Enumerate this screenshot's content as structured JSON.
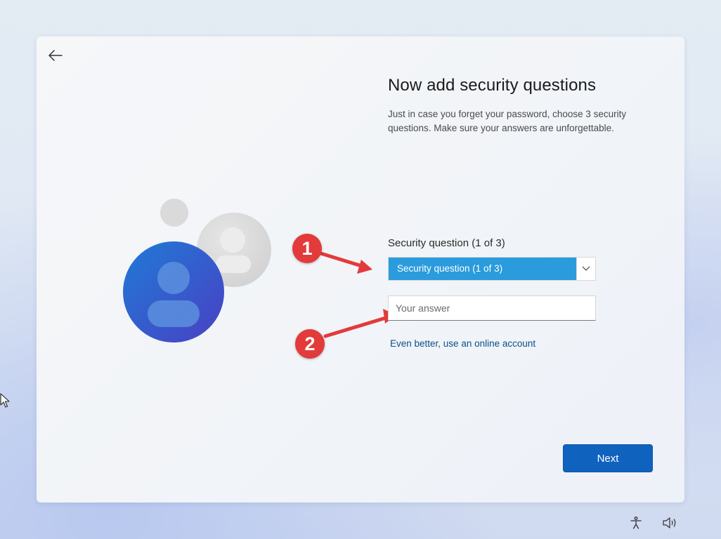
{
  "page": {
    "title": "Now add security questions",
    "subtitle": "Just in case you forget your password, choose 3 security questions. Make sure your answers are unforgettable."
  },
  "question": {
    "label": "Security question (1 of 3)",
    "selected": "Security question (1 of 3)"
  },
  "answer": {
    "placeholder": "Your answer",
    "value": ""
  },
  "links": {
    "online_account": "Even better, use an online account"
  },
  "buttons": {
    "next": "Next"
  },
  "annotations": {
    "one": "1",
    "two": "2"
  },
  "icons": {
    "back": "back-arrow-icon",
    "chevron": "chevron-down-icon",
    "accessibility": "accessibility-icon",
    "volume": "volume-icon"
  },
  "colors": {
    "accent": "#0f62be",
    "select_highlight": "#2a9bdc",
    "annotation": "#e33a3a",
    "link": "#0b4f8a"
  }
}
